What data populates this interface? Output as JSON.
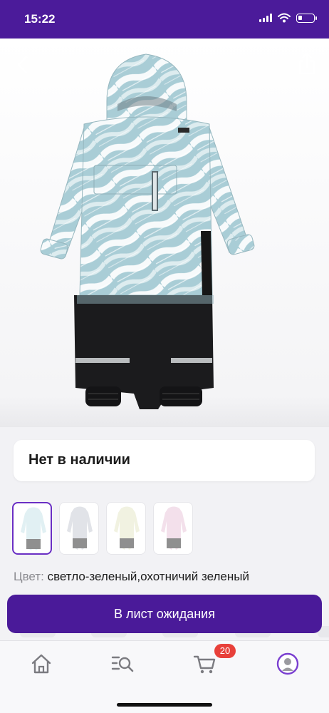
{
  "status_bar": {
    "time": "15:22"
  },
  "product": {
    "availability": "Нет в наличии",
    "color_label": "Цвет:",
    "color_value": "светло-зеленый,охотничий зеленый",
    "thumbnail_colors": [
      "#c9e3ea",
      "#c8cdd6",
      "#e5e8c8",
      "#e9c7da"
    ]
  },
  "actions": {
    "waitlist_button": "В лист ожидания"
  },
  "tab_bar": {
    "cart_badge": "20"
  },
  "colors": {
    "brand": "#4a1a99",
    "badge": "#e8403a"
  }
}
